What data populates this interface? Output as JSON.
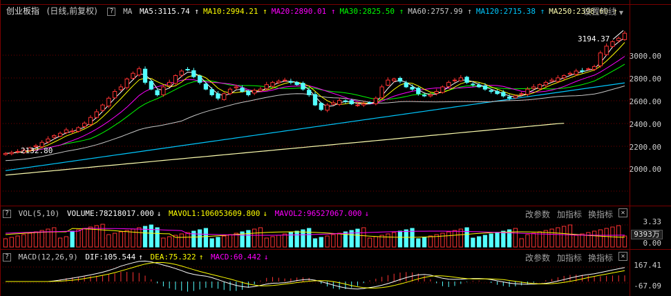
{
  "main": {
    "title": "创业板指",
    "period": "(日线,前复权)",
    "ma_tag": "MA",
    "ma_items": [
      {
        "label": "MA5:3115.74",
        "arrow": "↑",
        "color": "#ffffff"
      },
      {
        "label": "MA10:2994.21",
        "arrow": "↑",
        "color": "#ffff00"
      },
      {
        "label": "MA20:2890.01",
        "arrow": "↑",
        "color": "#ff00ff"
      },
      {
        "label": "MA30:2825.50",
        "arrow": "↑",
        "color": "#00ff00"
      },
      {
        "label": "MA60:2757.99",
        "arrow": "↑",
        "color": "#c8c8c8"
      },
      {
        "label": "MA120:2715.38",
        "arrow": "↑",
        "color": "#00c8ff"
      },
      {
        "label": "MA250:2398.60",
        "arrow": "↑",
        "color": "#ffffb0"
      }
    ],
    "settings_label": "设置均线",
    "high_label": "3194.37",
    "low_label": "2132.80",
    "y_ticks": [
      "3000.00",
      "2800.00",
      "2600.00",
      "2400.00",
      "2200.00",
      "2000.00"
    ]
  },
  "volume": {
    "name": "VOL(5,10)",
    "volume_label": "VOLUME:78218017.000",
    "volume_arrow": "↓",
    "mavol1_label": "MAVOL1:106053609.800",
    "mavol1_arrow": "↓",
    "mavol2_label": "MAVOL2:96527067.000",
    "mavol2_arrow": "↓",
    "btn_params": "改参数",
    "btn_add": "加指标",
    "btn_switch": "换指标",
    "y_top": "3.33",
    "y_mid": "9393万",
    "y_bottom": "0.00"
  },
  "macd": {
    "name": "MACD(12,26,9)",
    "dif_label": "DIF:105.544",
    "dif_arrow": "↑",
    "dea_label": "DEA:75.322",
    "dea_arrow": "↑",
    "macd_label": "MACD:60.442",
    "macd_arrow": "↓",
    "btn_params": "改参数",
    "btn_add": "加指标",
    "btn_switch": "换指标",
    "y_top": "167.41",
    "y_bottom": "-67.09"
  },
  "colors": {
    "up": "#ff3232",
    "down": "#54ffff",
    "grid": "#7a0000",
    "ma5": "#ffffff",
    "ma10": "#ffff00",
    "ma20": "#ff00ff",
    "ma30": "#00ff00",
    "ma60": "#c8c8c8",
    "ma120": "#00c8ff",
    "ma250": "#ffffb0"
  },
  "chart_data": {
    "type": "candlestick",
    "price_range": [
      1850,
      3250
    ],
    "closes": [
      2132,
      2140,
      2150,
      2160,
      2180,
      2200,
      2230,
      2260,
      2290,
      2310,
      2340,
      2330,
      2360,
      2400,
      2450,
      2500,
      2560,
      2620,
      2680,
      2720,
      2790,
      2840,
      2880,
      2760,
      2700,
      2650,
      2720,
      2760,
      2820,
      2860,
      2870,
      2810,
      2760,
      2700,
      2650,
      2620,
      2660,
      2700,
      2720,
      2680,
      2650,
      2690,
      2700,
      2740,
      2760,
      2770,
      2780,
      2760,
      2740,
      2700,
      2650,
      2560,
      2520,
      2560,
      2580,
      2600,
      2590,
      2570,
      2560,
      2570,
      2580,
      2620,
      2720,
      2780,
      2790,
      2770,
      2720,
      2700,
      2660,
      2640,
      2650,
      2680,
      2720,
      2760,
      2780,
      2800,
      2760,
      2740,
      2720,
      2700,
      2680,
      2660,
      2640,
      2620,
      2640,
      2660,
      2700,
      2720,
      2740,
      2760,
      2780,
      2800,
      2820,
      2840,
      2860,
      2860,
      2880,
      2900,
      3020,
      3080,
      3120,
      3150,
      3194
    ],
    "ma250": [
      1940,
      1945,
      1950,
      1955,
      1960,
      1965,
      1970,
      1975,
      1980,
      1985,
      1990,
      1995,
      2000,
      2005,
      2010,
      2015,
      2020,
      2025,
      2030,
      2035,
      2040,
      2045,
      2050,
      2055,
      2060,
      2065,
      2070,
      2075,
      2080,
      2085,
      2090,
      2095,
      2100,
      2105,
      2110,
      2115,
      2120,
      2125,
      2130,
      2135,
      2140,
      2145,
      2150,
      2155,
      2160,
      2165,
      2170,
      2175,
      2180,
      2185,
      2190,
      2195,
      2200,
      2205,
      2210,
      2215,
      2220,
      2225,
      2230,
      2235,
      2240,
      2245,
      2250,
      2255,
      2260,
      2265,
      2270,
      2275,
      2280,
      2285,
      2290,
      2295,
      2300,
      2305,
      2310,
      2315,
      2320,
      2325,
      2330,
      2335,
      2340,
      2345,
      2350,
      2355,
      2360,
      2365,
      2370,
      2375,
      2380,
      2385,
      2390,
      2395,
      2398
    ]
  }
}
